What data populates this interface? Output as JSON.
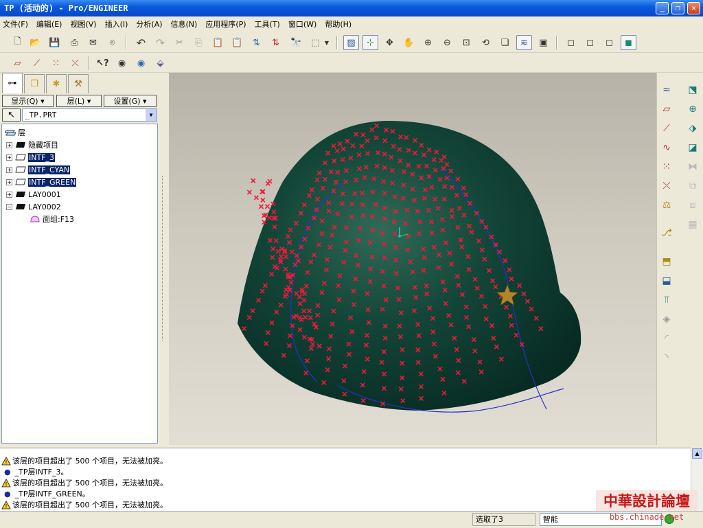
{
  "window": {
    "title": "TP (活动的) - Pro/ENGINEER"
  },
  "menu": [
    "文件(F)",
    "编辑(E)",
    "视图(V)",
    "插入(I)",
    "分析(A)",
    "信息(N)",
    "应用程序(P)",
    "工具(T)",
    "窗口(W)",
    "帮助(H)"
  ],
  "panel": {
    "show_label": "显示(Q)",
    "layer_label": "层(L)",
    "settings_label": "设置(G)",
    "model_name": "_TP.PRT",
    "root_label": "层",
    "layers": [
      {
        "label": "隐藏项目",
        "selected": false,
        "expanded": false
      },
      {
        "label": "INTF_3",
        "selected": true,
        "expanded": false
      },
      {
        "label": "INTF_CYAN",
        "selected": true,
        "expanded": false
      },
      {
        "label": "INTF_GREEN",
        "selected": true,
        "expanded": false
      },
      {
        "label": "LAY0001",
        "selected": false,
        "expanded": false
      },
      {
        "label": "LAY0002",
        "selected": false,
        "expanded": true
      }
    ],
    "child_item": "面组:F13"
  },
  "messages": [
    {
      "type": "warning",
      "text": "该层的项目超出了 500 个项目，无法被加亮。"
    },
    {
      "type": "info",
      "text": "_TP层INTF_3。"
    },
    {
      "type": "warning",
      "text": "该层的项目超出了 500 个项目，无法被加亮。"
    },
    {
      "type": "info",
      "text": "_TP层INTF_GREEN。"
    },
    {
      "type": "warning",
      "text": "该层的项目超出了 500 个项目，无法被加亮。"
    }
  ],
  "status": {
    "selected_text": "选取了3",
    "filter_value": "智能"
  },
  "watermark": {
    "main": "中華設計論壇",
    "url": "bbs.chinade.net"
  },
  "colors": {
    "titlebar": "#0a5ade",
    "model": "#0d3d30",
    "points": "#ee1a3a",
    "curve": "#2233cc",
    "selection": "#0a246a"
  }
}
